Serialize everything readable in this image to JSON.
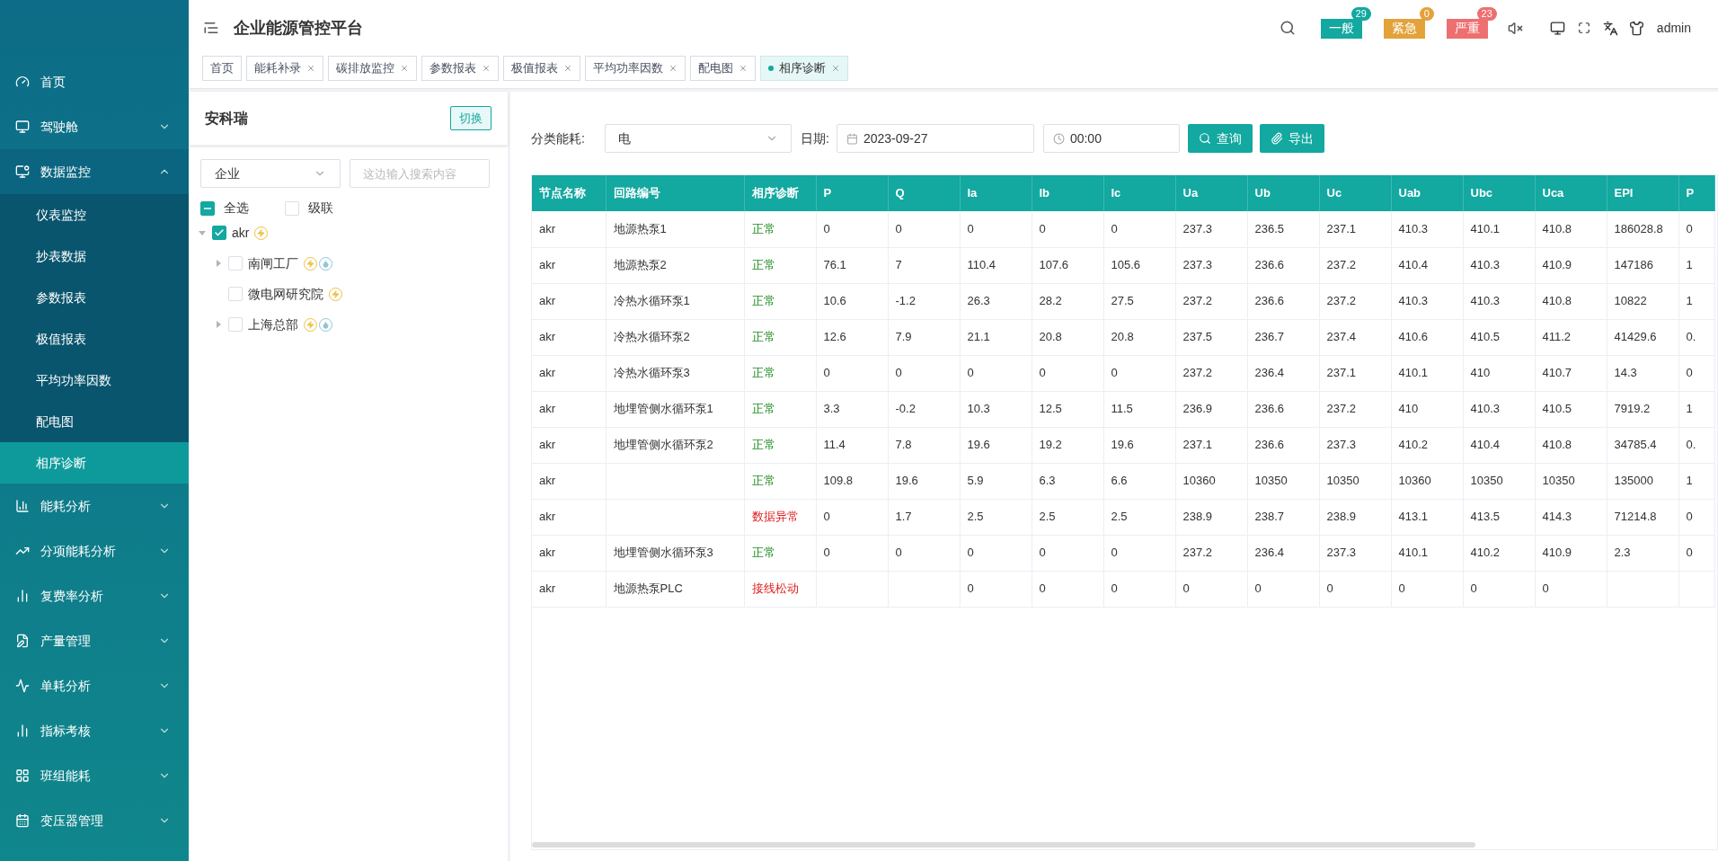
{
  "header": {
    "title": "企业能源管控平台",
    "alarms": [
      {
        "label": "一般",
        "count": "29",
        "color": "#13a8a0"
      },
      {
        "label": "紧急",
        "count": "0",
        "color": "#e3a23a"
      },
      {
        "label": "严重",
        "count": "23",
        "color": "#ee6f6f"
      }
    ],
    "user": "admin"
  },
  "tabs": [
    {
      "label": "首页",
      "selected": false,
      "closable": false
    },
    {
      "label": "能耗补录",
      "selected": false,
      "closable": true
    },
    {
      "label": "碳排放监控",
      "selected": false,
      "closable": true
    },
    {
      "label": "参数报表",
      "selected": false,
      "closable": true
    },
    {
      "label": "极值报表",
      "selected": false,
      "closable": true
    },
    {
      "label": "平均功率因数",
      "selected": false,
      "closable": true
    },
    {
      "label": "配电图",
      "selected": false,
      "closable": true
    },
    {
      "label": "相序诊断",
      "selected": true,
      "closable": true
    }
  ],
  "sidebar": {
    "items": [
      {
        "label": "首页",
        "expandable": false
      },
      {
        "label": "驾驶舱",
        "expandable": true,
        "expanded": false
      },
      {
        "label": "数据监控",
        "expandable": true,
        "expanded": true,
        "children": [
          {
            "label": "仪表监控",
            "selected": false
          },
          {
            "label": "抄表数据",
            "selected": false
          },
          {
            "label": "参数报表",
            "selected": false
          },
          {
            "label": "极值报表",
            "selected": false
          },
          {
            "label": "平均功率因数",
            "selected": false
          },
          {
            "label": "配电图",
            "selected": false
          },
          {
            "label": "相序诊断",
            "selected": true
          }
        ]
      },
      {
        "label": "能耗分析",
        "expandable": true,
        "expanded": false
      },
      {
        "label": "分项能耗分析",
        "expandable": true,
        "expanded": false
      },
      {
        "label": "复费率分析",
        "expandable": true,
        "expanded": false
      },
      {
        "label": "产量管理",
        "expandable": true,
        "expanded": false
      },
      {
        "label": "单耗分析",
        "expandable": true,
        "expanded": false
      },
      {
        "label": "指标考核",
        "expandable": true,
        "expanded": false
      },
      {
        "label": "班组能耗",
        "expandable": true,
        "expanded": false
      },
      {
        "label": "变压器管理",
        "expandable": true,
        "expanded": false
      }
    ]
  },
  "tree_panel": {
    "title": "安科瑞",
    "switch_button": "切换",
    "type_select": "企业",
    "search": {
      "placeholder": "这边输入搜索内容"
    },
    "select_all": {
      "label": "全选",
      "indeterminate": true
    },
    "cascade": {
      "label": "级联",
      "checked": false
    },
    "tree": [
      {
        "label": "akr",
        "checked": true,
        "expanded": true,
        "power": true,
        "children": [
          {
            "label": "南闸工厂",
            "checked": false,
            "expanded": false,
            "power": true,
            "water": true
          },
          {
            "label": "微电网研究院",
            "checked": false,
            "power": true
          },
          {
            "label": "上海总部",
            "checked": false,
            "expanded": false,
            "power": true,
            "water": true
          }
        ]
      }
    ]
  },
  "filters": {
    "category_label": "分类能耗:",
    "category": "电",
    "date_label": "日期:",
    "date": "2023-09-27",
    "time": "00:00",
    "query_button": "查询",
    "export_button": "导出"
  },
  "table": {
    "columns": [
      "节点名称",
      "回路编号",
      "相序诊断",
      "P",
      "Q",
      "Ia",
      "Ib",
      "Ic",
      "Ua",
      "Ub",
      "Uc",
      "Uab",
      "Ubc",
      "Uca",
      "EPI",
      "P"
    ],
    "rows": [
      {
        "abnormal": false,
        "cells": [
          "akr",
          "地源热泵1",
          "正常",
          "0",
          "0",
          "0",
          "0",
          "0",
          "237.3",
          "236.5",
          "237.1",
          "410.3",
          "410.1",
          "410.8",
          "186028.8",
          "0"
        ]
      },
      {
        "abnormal": false,
        "cells": [
          "akr",
          "地源热泵2",
          "正常",
          "76.1",
          "7",
          "110.4",
          "107.6",
          "105.6",
          "237.3",
          "236.6",
          "237.2",
          "410.4",
          "410.3",
          "410.9",
          "147186",
          "1"
        ]
      },
      {
        "abnormal": false,
        "cells": [
          "akr",
          "冷热水循环泵1",
          "正常",
          "10.6",
          "-1.2",
          "26.3",
          "28.2",
          "27.5",
          "237.2",
          "236.6",
          "237.2",
          "410.3",
          "410.3",
          "410.8",
          "10822",
          "1"
        ]
      },
      {
        "abnormal": false,
        "cells": [
          "akr",
          "冷热水循环泵2",
          "正常",
          "12.6",
          "7.9",
          "21.1",
          "20.8",
          "20.8",
          "237.5",
          "236.7",
          "237.4",
          "410.6",
          "410.5",
          "411.2",
          "41429.6",
          "0."
        ]
      },
      {
        "abnormal": false,
        "cells": [
          "akr",
          "冷热水循环泵3",
          "正常",
          "0",
          "0",
          "0",
          "0",
          "0",
          "237.2",
          "236.4",
          "237.1",
          "410.1",
          "410",
          "410.7",
          "14.3",
          "0"
        ]
      },
      {
        "abnormal": false,
        "cells": [
          "akr",
          "地埋管侧水循环泵1",
          "正常",
          "3.3",
          "-0.2",
          "10.3",
          "12.5",
          "11.5",
          "236.9",
          "236.6",
          "237.2",
          "410",
          "410.3",
          "410.5",
          "7919.2",
          "1"
        ]
      },
      {
        "abnormal": false,
        "cells": [
          "akr",
          "地埋管侧水循环泵2",
          "正常",
          "11.4",
          "7.8",
          "19.6",
          "19.2",
          "19.6",
          "237.1",
          "236.6",
          "237.3",
          "410.2",
          "410.4",
          "410.8",
          "34785.4",
          "0."
        ]
      },
      {
        "abnormal": false,
        "cells": [
          "akr",
          "",
          "正常",
          "109.8",
          "19.6",
          "5.9",
          "6.3",
          "6.6",
          "10360",
          "10350",
          "10350",
          "10360",
          "10350",
          "10350",
          "135000",
          "1"
        ]
      },
      {
        "abnormal": true,
        "cells": [
          "akr",
          "",
          "数据异常",
          "0",
          "1.7",
          "2.5",
          "2.5",
          "2.5",
          "238.9",
          "238.7",
          "238.9",
          "413.1",
          "413.5",
          "414.3",
          "71214.8",
          "0"
        ]
      },
      {
        "abnormal": false,
        "cells": [
          "akr",
          "地埋管侧水循环泵3",
          "正常",
          "0",
          "0",
          "0",
          "0",
          "0",
          "237.2",
          "236.4",
          "237.3",
          "410.1",
          "410.2",
          "410.9",
          "2.3",
          "0"
        ]
      },
      {
        "abnormal": true,
        "cells": [
          "akr",
          "地源热泵PLC",
          "接线松动",
          "",
          "",
          "0",
          "0",
          "0",
          "0",
          "0",
          "0",
          "0",
          "0",
          "0",
          "",
          ""
        ]
      }
    ]
  }
}
